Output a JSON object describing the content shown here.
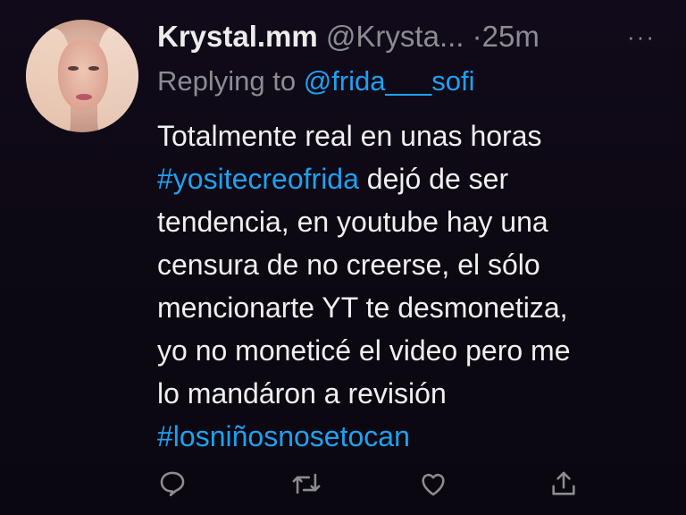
{
  "tweet": {
    "display_name": "Krystal.mm",
    "handle": "@Krysta...",
    "separator": "·",
    "time": "25m",
    "more": "···",
    "reply_label": "Replying to",
    "reply_to": "@frida___sofi",
    "lines": [
      {
        "text": "Totalmente real en unas horas"
      },
      {
        "hashtag": "#yositecreofrida",
        "text": " dejó de ser"
      },
      {
        "text": "tendencia, en youtube hay una"
      },
      {
        "text": "censura de no creerse, el sólo"
      },
      {
        "text": "mencionarte YT te desmonetiza,"
      },
      {
        "text": "yo no moneticé el video pero me"
      },
      {
        "text": "lo mandáron a revisión"
      },
      {
        "hashtag": "#losniñosnosetocan"
      }
    ]
  },
  "actions": [
    {
      "name": "reply-icon"
    },
    {
      "name": "retweet-icon"
    },
    {
      "name": "like-icon"
    },
    {
      "name": "share-icon"
    }
  ],
  "colors": {
    "background": "#0c0812",
    "link": "#1da1f2",
    "muted": "#8b8d91",
    "text": "#f0f0f0"
  }
}
